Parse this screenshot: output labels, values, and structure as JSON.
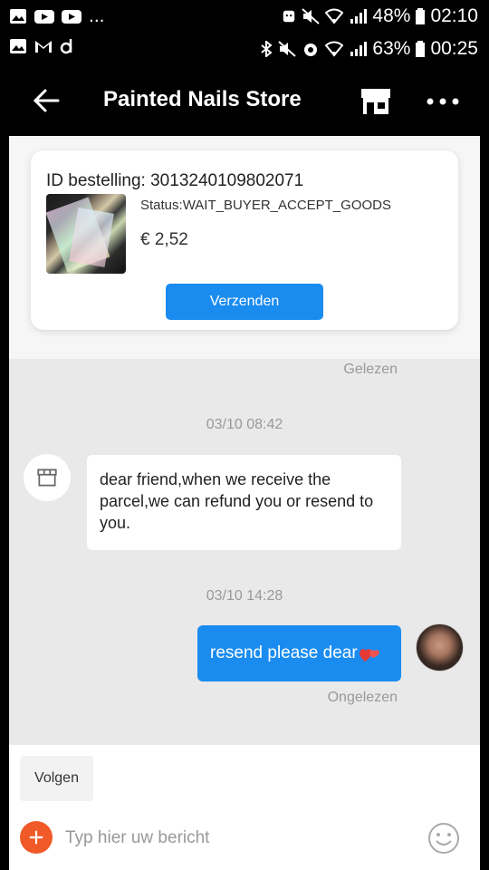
{
  "statusbar_top": {
    "left_icons": [
      "image-icon",
      "youtube-icon",
      "youtube-icon",
      "more-dots"
    ],
    "more_text": "...",
    "battery": "48%",
    "time": "02:10"
  },
  "statusbar_second": {
    "left_icons": [
      "image-icon",
      "gmail-icon",
      "d-icon"
    ],
    "battery": "63%",
    "time": "00:25"
  },
  "appbar": {
    "title": "Painted Nails Store"
  },
  "order": {
    "id_label": "ID bestelling: 3013240109802071",
    "status": "Status:WAIT_BUYER_ACCEPT_GOODS",
    "price": "€ 2,52",
    "send_label": "Verzenden"
  },
  "chat": {
    "read_top": "Gelezen",
    "time1": "03/10 08:42",
    "incoming_message": "dear friend,when we receive the parcel,we can refund you or resend to you.",
    "time2": "03/10 14:28",
    "outgoing_message": "resend please dear",
    "read_bottom": "Ongelezen"
  },
  "footer": {
    "follow_label": "Volgen",
    "input_placeholder": "Typ hier uw bericht"
  },
  "colors": {
    "accent": "#1a8cf0",
    "plus": "#f05a28"
  }
}
